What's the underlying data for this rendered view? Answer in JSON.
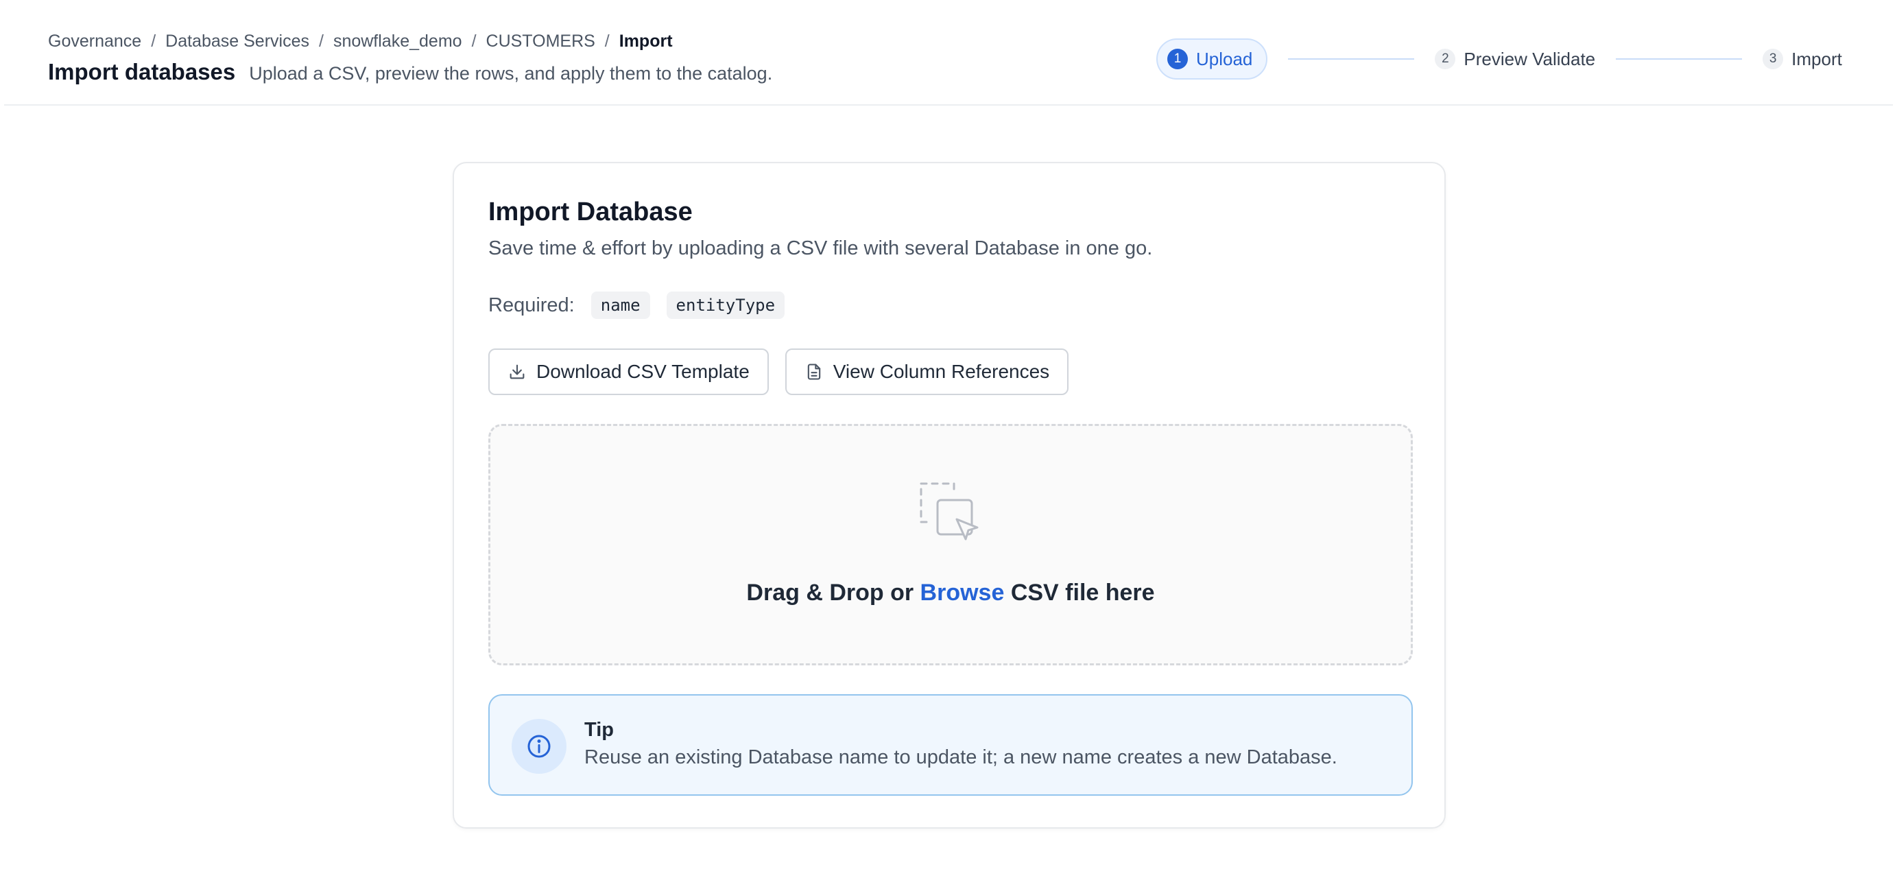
{
  "breadcrumb": {
    "items": [
      "Governance",
      "Database Services",
      "snowflake_demo",
      "CUSTOMERS"
    ],
    "separator": "/",
    "current": "Import"
  },
  "header": {
    "title": "Import databases",
    "subtitle": "Upload a CSV, preview the rows, and apply them to the catalog."
  },
  "stepper": {
    "active_index": 0,
    "steps": [
      {
        "number": "1",
        "label": "Upload"
      },
      {
        "number": "2",
        "label": "Preview Validate"
      },
      {
        "number": "3",
        "label": "Import"
      }
    ]
  },
  "card": {
    "title": "Import Database",
    "description": "Save time & effort by uploading a CSV file with several Database in one go.",
    "required_label": "Required:",
    "required_fields": [
      "name",
      "entityType"
    ],
    "buttons": {
      "download_template": {
        "label": "Download CSV Template",
        "icon": "download-icon"
      },
      "column_references": {
        "label": "View Column References",
        "icon": "document-icon"
      }
    },
    "dropzone": {
      "icon": "drag-drop-icon",
      "text_before": "Drag & Drop or",
      "browse": "Browse",
      "text_after": "CSV file here"
    },
    "tip": {
      "icon": "info-icon",
      "title": "Tip",
      "text": "Reuse an existing Database name to update it; a new name creates a new Database."
    }
  },
  "colors": {
    "accent": "#2563d6",
    "tip_background": "#f0f7fe",
    "tip_border": "#93c5ee"
  }
}
